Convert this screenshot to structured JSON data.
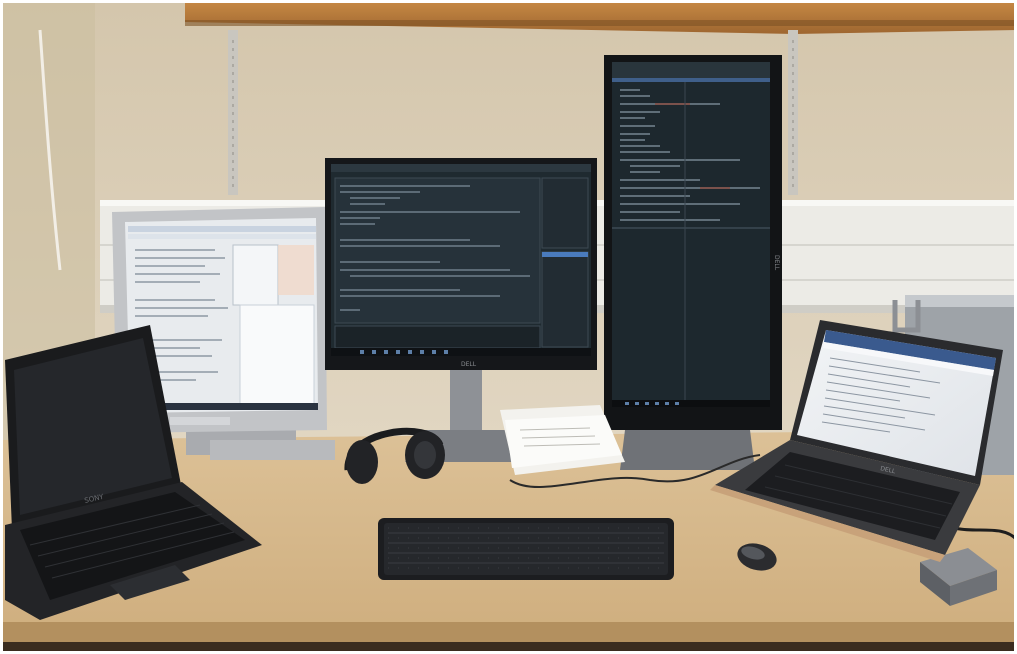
{
  "scene": {
    "description_objects": [
      "wall-shelf",
      "laptop-left",
      "monitor-old-square",
      "monitor-center",
      "monitor-portrait",
      "laptop-right",
      "keyboard",
      "mouse",
      "headphones",
      "papers",
      "external-drive",
      "desk"
    ]
  },
  "logos": {
    "laptop_left_brand": "SONY",
    "monitor_center_brand": "DELL",
    "monitor_portrait_brand": "DELL",
    "laptop_right_brand": "DELL"
  },
  "colors": {
    "wall": "#d9cdb6",
    "shelf": "#b57a3c",
    "desk": "#d8b98a",
    "desk_edge": "#a8865c",
    "screen_dark": "#1f262b",
    "screen_light": "#e9ecef",
    "device_black": "#1b1c1e",
    "device_silver": "#b9bbbf",
    "radiator": "#ecebe6"
  }
}
